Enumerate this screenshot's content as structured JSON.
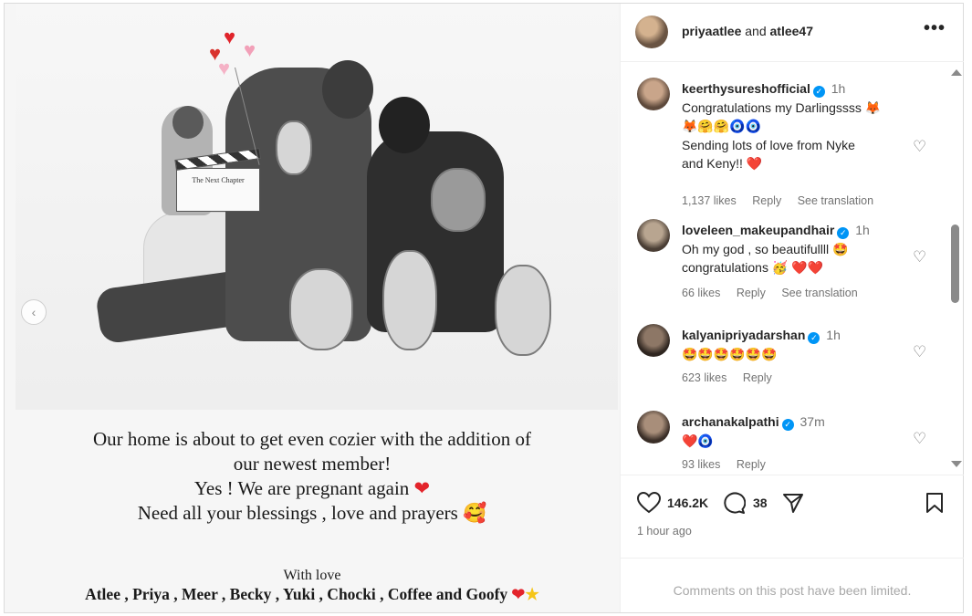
{
  "post": {
    "header_user1": "priyaatlee",
    "header_and": "and",
    "header_user2": "atlee47",
    "more_label": "•••"
  },
  "media": {
    "clapboard_text": "The Next Chapter",
    "caption_lines": [
      "Our home is about to get even cozier with the addition of",
      "our newest member!",
      "Yes ! We are pregnant again",
      "Need all your blessings , love and prayers"
    ],
    "with_love": "With love",
    "names": "Atlee , Priya , Meer , Becky , Yuki , Chocki , Coffee and Goofy",
    "prev_icon": "‹"
  },
  "comments": [
    {
      "user": "keerthysureshofficial",
      "time": "1h",
      "lines": [
        "Congratulations my Darlingssss 🦊",
        "🦊🤗🤗🧿🧿",
        "Sending lots of love from Nyke",
        "and Keny!! ❤️"
      ],
      "likes": "1,137 likes",
      "reply": "Reply",
      "translate": "See translation"
    },
    {
      "user": "loveleen_makeupandhair",
      "time": "1h",
      "lines": [
        "Oh my god , so beautifullll 🤩",
        "congratulations 🥳 ❤️❤️"
      ],
      "likes": "66 likes",
      "reply": "Reply",
      "translate": "See translation"
    },
    {
      "user": "kalyanipriyadarshan",
      "time": "1h",
      "lines": [
        "🤩🤩🤩🤩🤩🤩"
      ],
      "likes": "623 likes",
      "reply": "Reply",
      "translate": ""
    },
    {
      "user": "archanakalpathi",
      "time": "37m",
      "lines": [
        "❤️🧿"
      ],
      "likes": "93 likes",
      "reply": "Reply",
      "translate": ""
    }
  ],
  "actions": {
    "likes_count": "146.2K",
    "comments_count": "38",
    "posted_time": "1 hour ago"
  },
  "footer": {
    "limited_text": "Comments on this post have been limited."
  }
}
